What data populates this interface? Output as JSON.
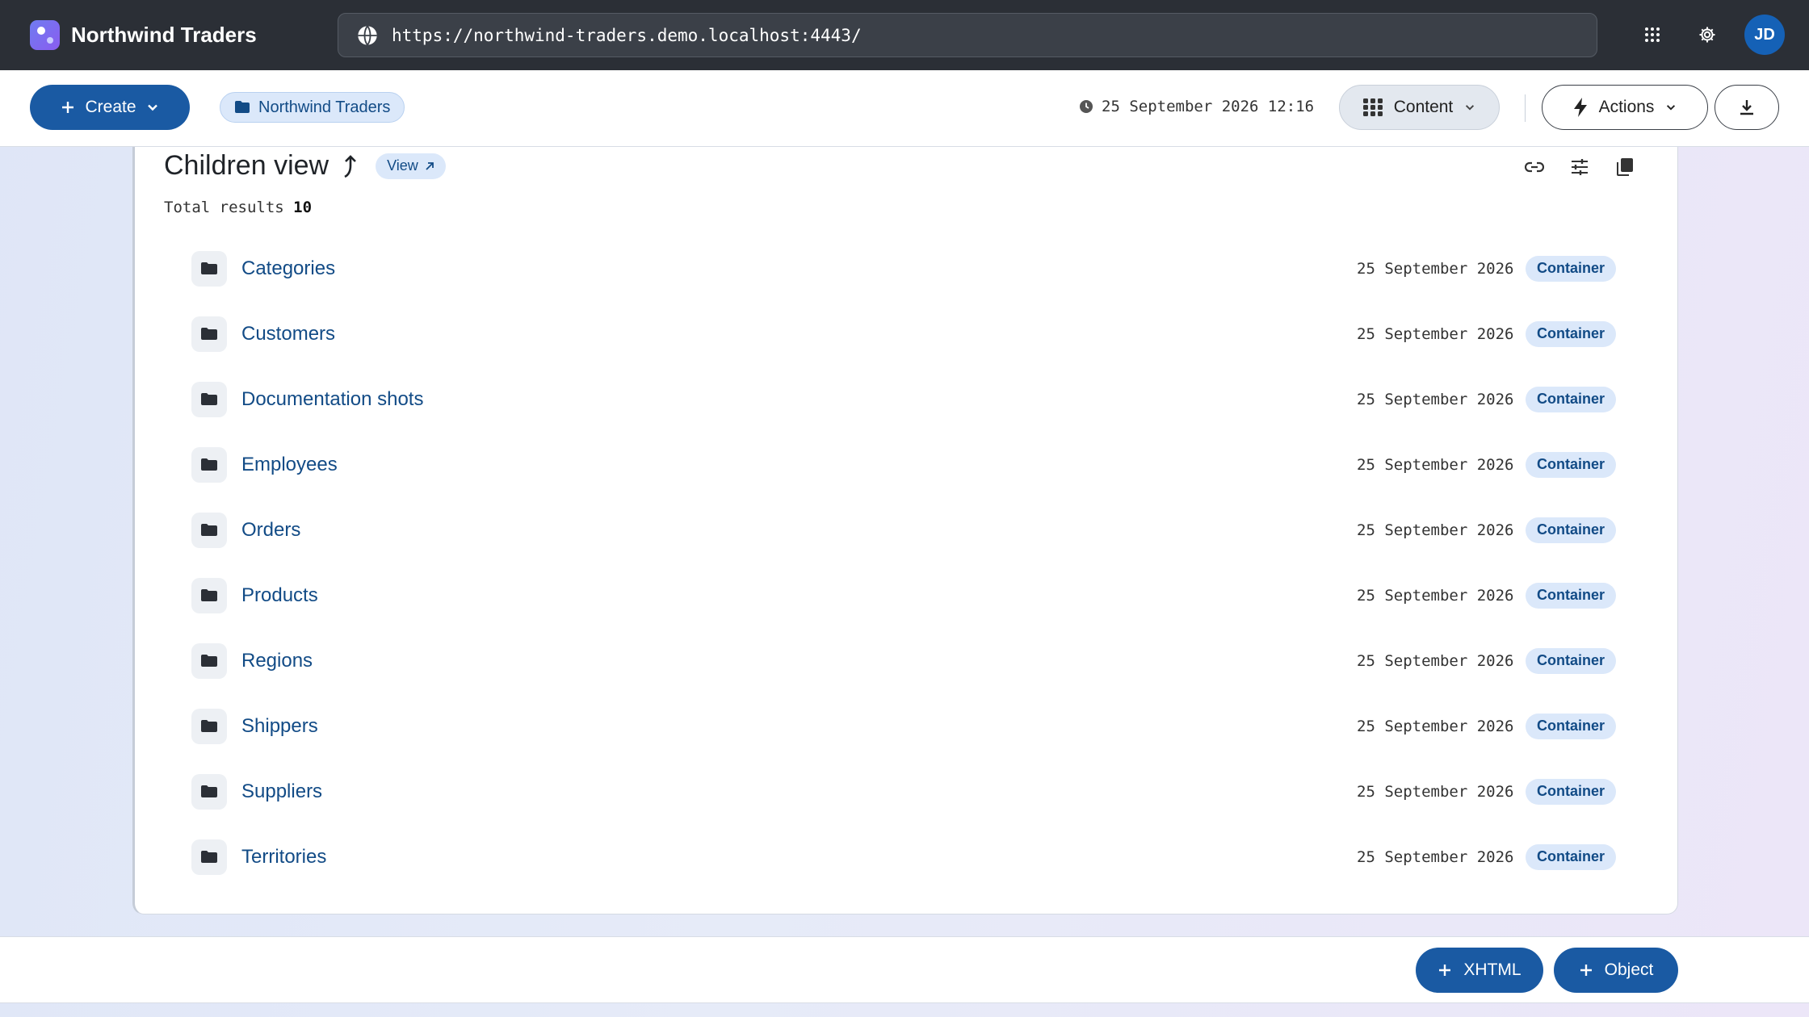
{
  "app": {
    "name": "Northwind Traders"
  },
  "address_bar": {
    "url": "https://northwind-traders.demo.localhost:4443/"
  },
  "user": {
    "initials": "JD"
  },
  "toolbar": {
    "create_label": "Create",
    "breadcrumb_label": "Northwind Traders",
    "timestamp": "25 September 2026 12:16",
    "content_label": "Content",
    "actions_label": "Actions"
  },
  "panel": {
    "title": "Children view",
    "view_badge": "View",
    "total_label": "Total results",
    "total_count": "10"
  },
  "children": [
    {
      "name": "Categories",
      "date": "25 September 2026",
      "type": "Container"
    },
    {
      "name": "Customers",
      "date": "25 September 2026",
      "type": "Container"
    },
    {
      "name": "Documentation shots",
      "date": "25 September 2026",
      "type": "Container"
    },
    {
      "name": "Employees",
      "date": "25 September 2026",
      "type": "Container"
    },
    {
      "name": "Orders",
      "date": "25 September 2026",
      "type": "Container"
    },
    {
      "name": "Products",
      "date": "25 September 2026",
      "type": "Container"
    },
    {
      "name": "Regions",
      "date": "25 September 2026",
      "type": "Container"
    },
    {
      "name": "Shippers",
      "date": "25 September 2026",
      "type": "Container"
    },
    {
      "name": "Suppliers",
      "date": "25 September 2026",
      "type": "Container"
    },
    {
      "name": "Territories",
      "date": "25 September 2026",
      "type": "Container"
    }
  ],
  "bottom": {
    "xhtml_label": "XHTML",
    "object_label": "Object"
  },
  "colors": {
    "primary": "#1a5aa3",
    "topbar": "#2b2f36",
    "badge_bg": "#dbe8fa",
    "link": "#124b86"
  }
}
